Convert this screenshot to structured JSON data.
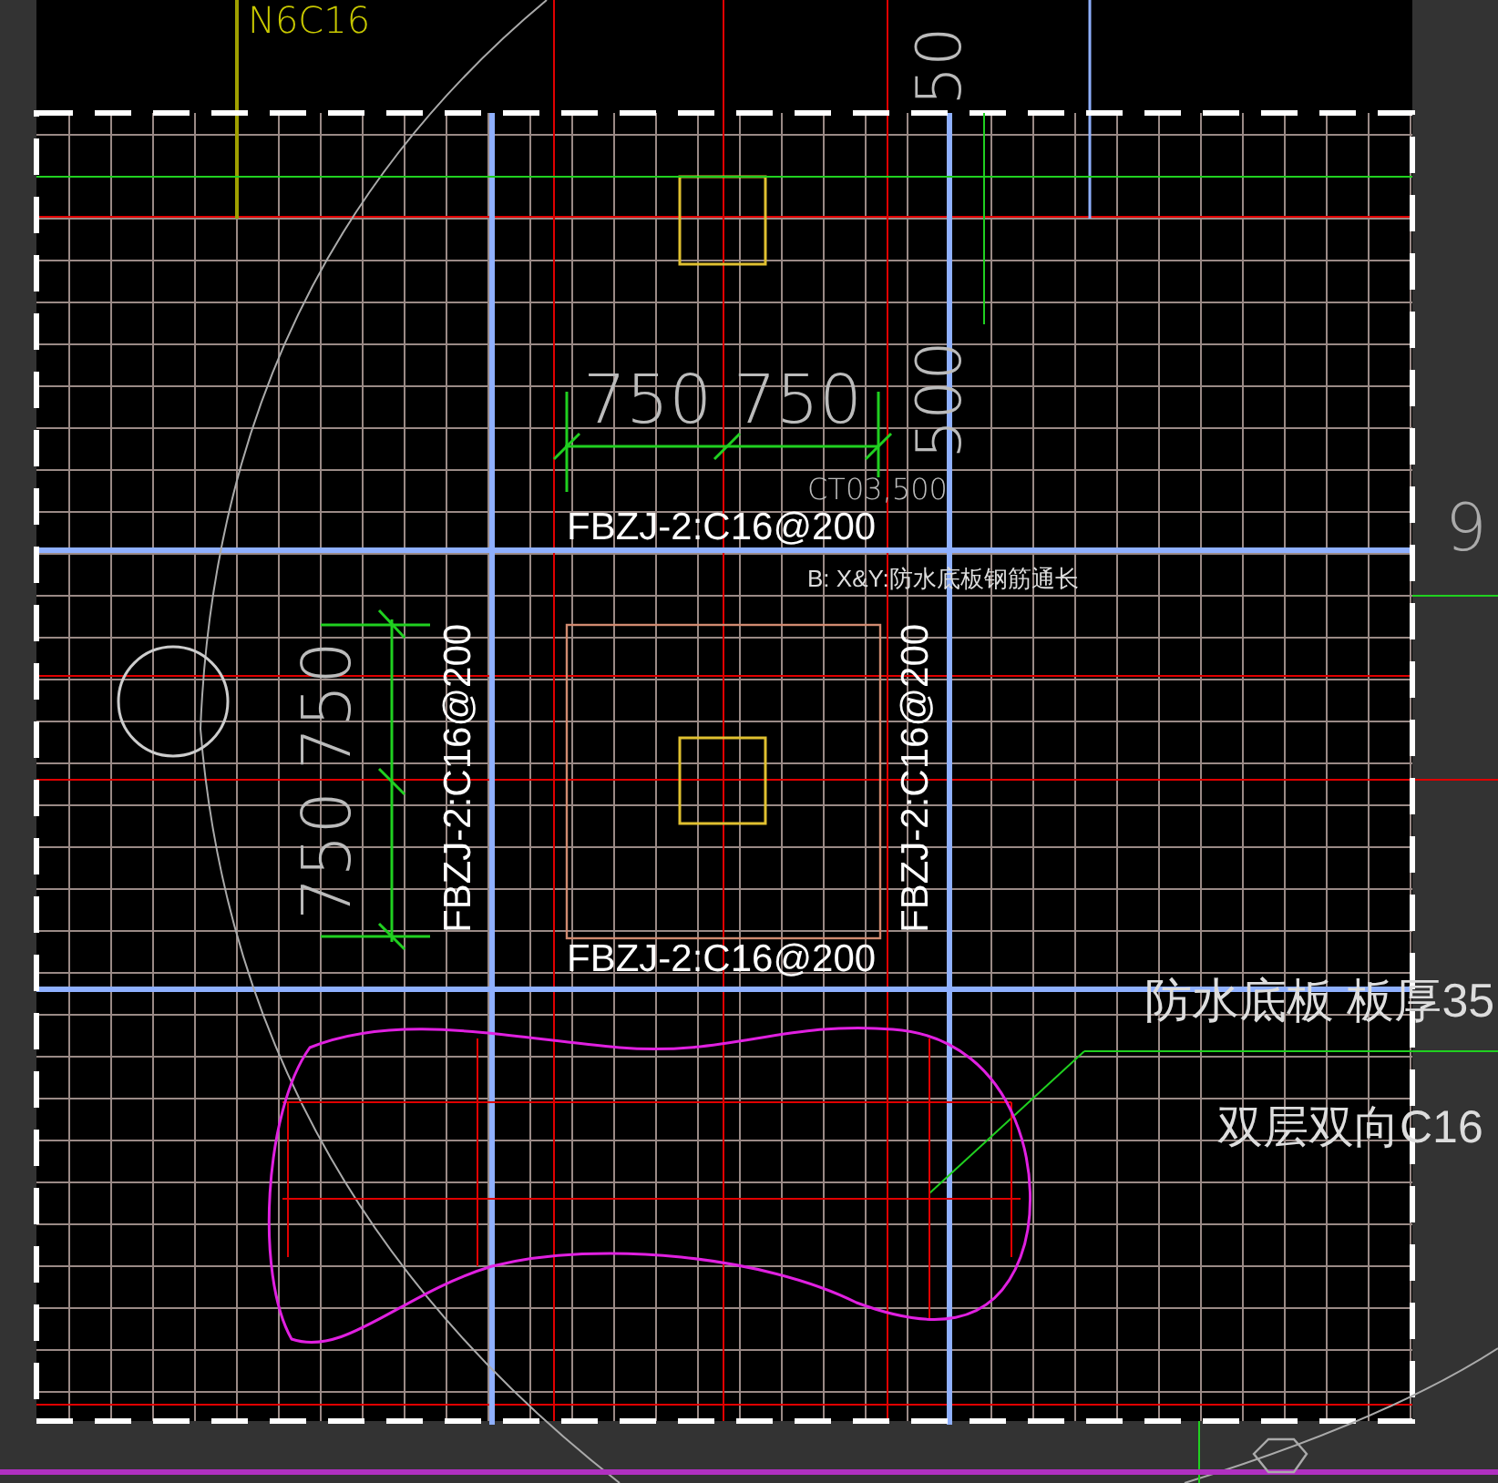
{
  "drawing": {
    "labels": [
      "N6C16",
      "50",
      "750 750",
      "500",
      "FBZJ-2:C16@200",
      "CT03,500",
      "B: X&Y:防水底板钢筋通长",
      "750 750",
      "FBZJ-2:C16@200",
      "FBZJ-2:C16@200",
      "FBZJ-2:C16@200",
      "9",
      "防水底板 板厚35",
      "双层双向C16"
    ]
  }
}
